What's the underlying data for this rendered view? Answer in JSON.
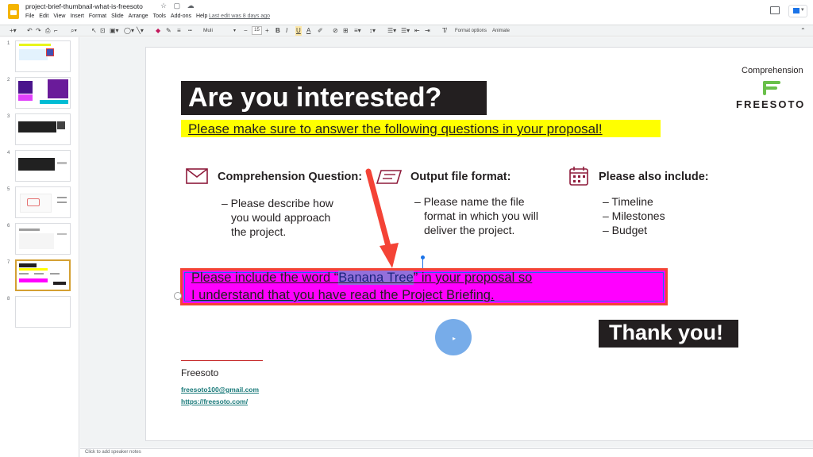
{
  "header": {
    "doc_title": "project-brief-thumbnail-what-is-freesoto",
    "doc_icons": "☆ ▢ ☁",
    "menu": [
      "File",
      "Edit",
      "View",
      "Insert",
      "Format",
      "Slide",
      "Arrange",
      "Tools",
      "Add-ons",
      "Help"
    ],
    "last_edit": "Last edit was 8 days ago"
  },
  "toolbar": {
    "font_name": "Muli",
    "font_size": "15",
    "format_options": "Format options",
    "animate": "Animate"
  },
  "filmstrip": {
    "slides": [
      {
        "num": "1"
      },
      {
        "num": "2"
      },
      {
        "num": "3"
      },
      {
        "num": "4"
      },
      {
        "num": "5"
      },
      {
        "num": "6"
      },
      {
        "num": "7"
      },
      {
        "num": "8"
      }
    ],
    "selected_index": 7
  },
  "slide": {
    "title": "Are you interested?",
    "subtitle": "Please make sure to answer the following questions in your proposal!",
    "brand_label": "Comprehension",
    "brand_name": "FREESOTO",
    "columns": [
      {
        "icon": "envelope-icon",
        "heading": "Comprehension Question:",
        "body": [
          "– Please describe how",
          "you would approach",
          "the project."
        ]
      },
      {
        "icon": "file-format-icon",
        "heading": "Output file format:",
        "body": [
          "– Please name the file",
          "format in which you will",
          "deliver the project."
        ]
      },
      {
        "icon": "calendar-icon",
        "heading": "Please also include:",
        "body": [
          "– Timeline",
          "– Milestones",
          "– Budget"
        ]
      }
    ],
    "highlight": {
      "line1_pre": "Please include the word “",
      "line1_word": "Banana Tree",
      "line1_post": "” in your proposal so",
      "line2": "I understand that you have read the Project Briefing."
    },
    "thanks": "Thank you!",
    "footer": {
      "name": "Freesoto",
      "email": "freesoto100@gmail.com",
      "url": "https://freesoto.com/"
    }
  },
  "notes": {
    "placeholder": "Click to add speaker notes"
  },
  "colors": {
    "accent_red": "#f44336",
    "highlight_magenta": "#ff00ff",
    "highlight_yellow": "#ffff00",
    "brand_green": "#6ac04a",
    "dark": "#231f20"
  }
}
